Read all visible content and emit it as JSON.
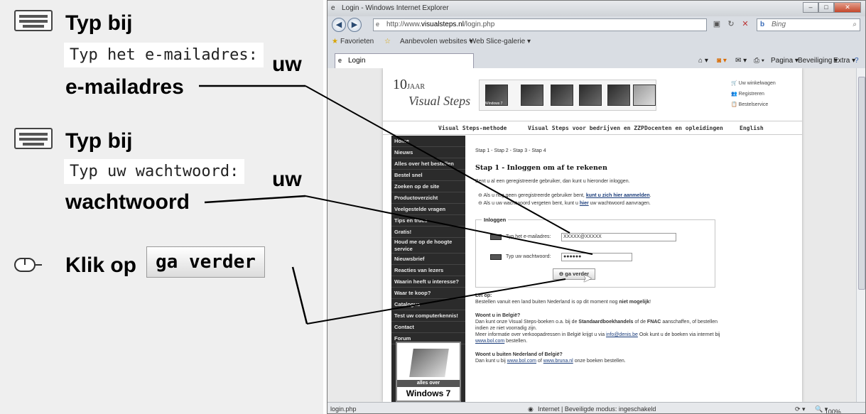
{
  "instructions": {
    "step1": {
      "verb": "Typ bij",
      "field_label": "Typ het e-mailadres:",
      "value_word1": "uw",
      "value_word2": "e-mailadres"
    },
    "step2": {
      "verb": "Typ bij",
      "field_label": "Typ uw wachtwoord:",
      "value_word1": "uw",
      "value_word2": "wachtwoord"
    },
    "step3": {
      "verb": "Klik op",
      "button_label": "ga verder"
    }
  },
  "browser": {
    "window_title": "Login - Windows Internet Explorer",
    "url_prefix": "http://www.",
    "url_domain": "visualsteps.nl",
    "url_path": "/login.php",
    "search_placeholder": "Bing",
    "search_engine": "b",
    "favorites_label": "Favorieten",
    "fav_suggested": "Aanbevolen websites ▾",
    "fav_webslice": "Web Slice-galerie ▾",
    "tab_title": "Login",
    "cmd_page": "Pagina ▾",
    "cmd_security": "Beveiliging ▾",
    "cmd_extra": "Extra ▾",
    "status_left": "login.php",
    "status_zone": "Internet | Beveiligde modus: ingeschakeld",
    "status_zoom": "100%"
  },
  "site": {
    "logo_ten": "10",
    "logo_jaar": "JAAR",
    "logo_name": "Visual Steps",
    "banner_badge": "Windows 7",
    "shop_links": [
      "Uw winkelwagen",
      "Registreren",
      "Bestelservice"
    ],
    "topnav": [
      "Visual Steps-methode",
      "Visual Steps voor bedrijven en ZZP",
      "Docenten en opleidingen",
      "English"
    ],
    "leftnav": [
      "Home",
      "Nieuws",
      "Alles over het bestellen",
      "Bestel snel",
      "Zoeken op de site",
      "Productoverzicht",
      "Veelgestelde vragen",
      "Tips en trucs",
      "Gratis!",
      "Houd me op de hoogte service",
      "Nieuwsbrief",
      "Reacties van lezers",
      "Waarin heeft u interesse?",
      "Waar te koop?",
      "Catalogus",
      "Test uw computerkennis!",
      "Contact",
      "Forum"
    ],
    "promo_strip": "alles over",
    "promo_title": "Windows 7",
    "steps_breadcrumb": "Stap 1 - Stap 2 - Stap 3 - Stap 4",
    "heading": "Stap 1 - Inloggen om af te rekenen",
    "intro": "Bent u al een geregistreerde gebruiker, dan kunt u hieronder inloggen.",
    "note1_pre": "Als u nog geen geregistreerde gebruiker bent, ",
    "note1_link": "kunt u zich hier aanmelden",
    "note2_pre": "Als u uw wachtwoord vergeten bent, kunt u ",
    "note2_link": "hier",
    "note2_post": " uw wachtwoord aanvragen.",
    "login_legend": "Inloggen",
    "email_label": "Typ het e-mailadres:",
    "email_value": "XXXXX@XXXXX",
    "pw_label": "Typ uw wachtwoord:",
    "pw_value": "●●●●●●",
    "submit_label": "ga verder",
    "letop_title": "Let op:",
    "letop_pre": "Bestellen vanuit een land buiten Nederland is op dit moment nog ",
    "letop_bold": "niet mogelijk",
    "letop_post": "!",
    "be_title": "Woont u in België?",
    "be_line1_pre": "Dan kunt onze Visual Steps-boeken o.a. bij de ",
    "be_line1_b1": "Standaardboekhandels",
    "be_line1_mid": " of de ",
    "be_line1_b2": "FNAC",
    "be_line1_post": " aanschaffen, of bestellen",
    "be_line2": "indien ze niet voorradig zijn.",
    "be_line3_pre": "Meer informatie over verkoopadressen in België krijgt u via ",
    "be_line3_link": "info@denis.be",
    "be_line3_post": " Ook kunt u de boeken via internet bij",
    "be_line4_link": "www.bol.com",
    "be_line4_post": " bestellen.",
    "nbe_title": "Woont u buiten Nederland of België?",
    "nbe_pre": "Dan kunt u bij ",
    "nbe_link1": "www.bol.com",
    "nbe_mid": " of ",
    "nbe_link2": "www.bruna.nl",
    "nbe_post": " onze boeken bestellen."
  }
}
